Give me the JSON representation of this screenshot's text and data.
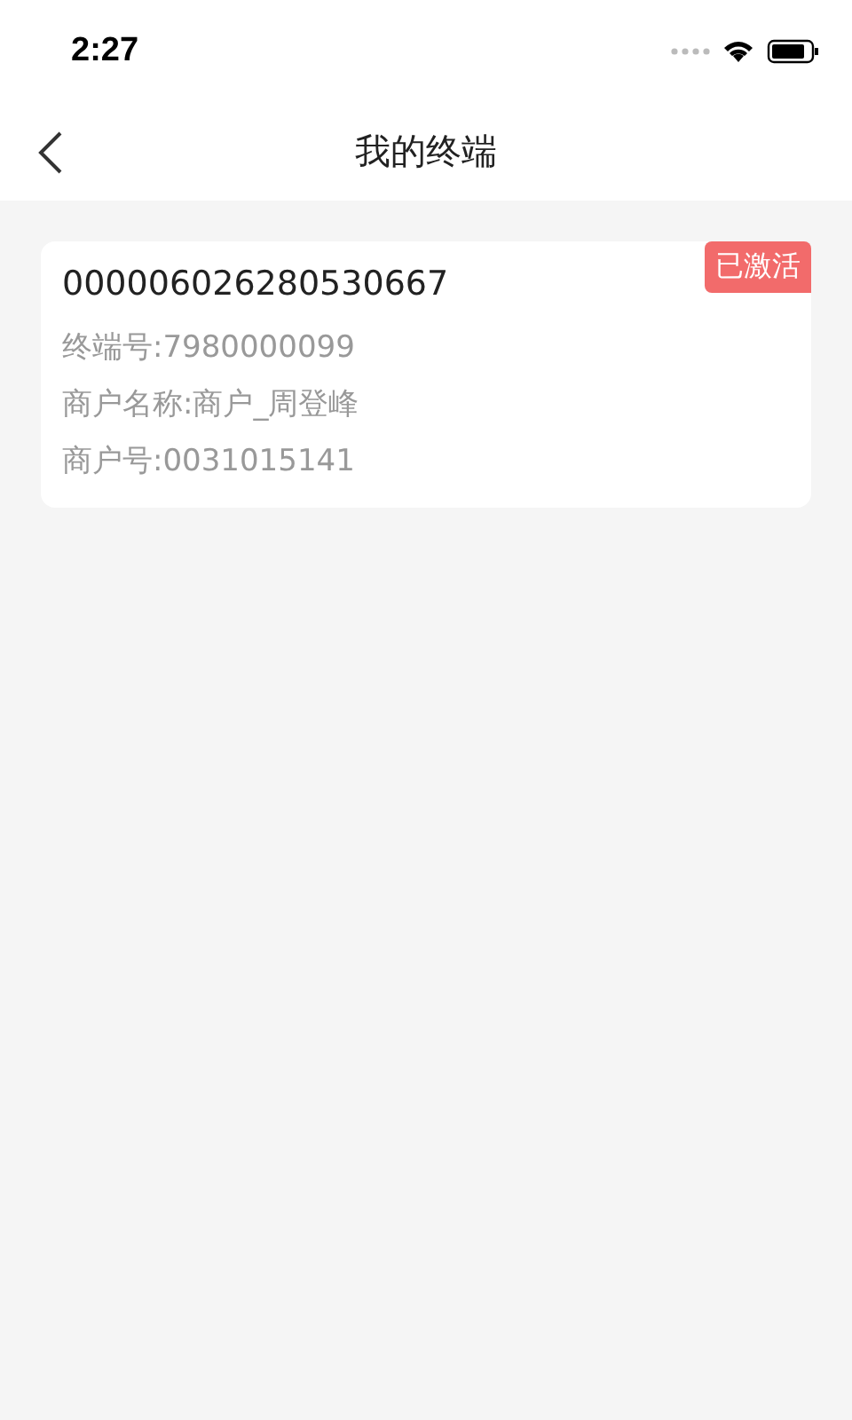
{
  "status_bar": {
    "time": "2:27"
  },
  "nav": {
    "title": "我的终端"
  },
  "terminals": [
    {
      "serial": "000006026280530667",
      "badge": "已激活",
      "lines": [
        "终端号:7980000099",
        "商户名称:商户_周登峰",
        "商户号:0031015141"
      ]
    }
  ]
}
